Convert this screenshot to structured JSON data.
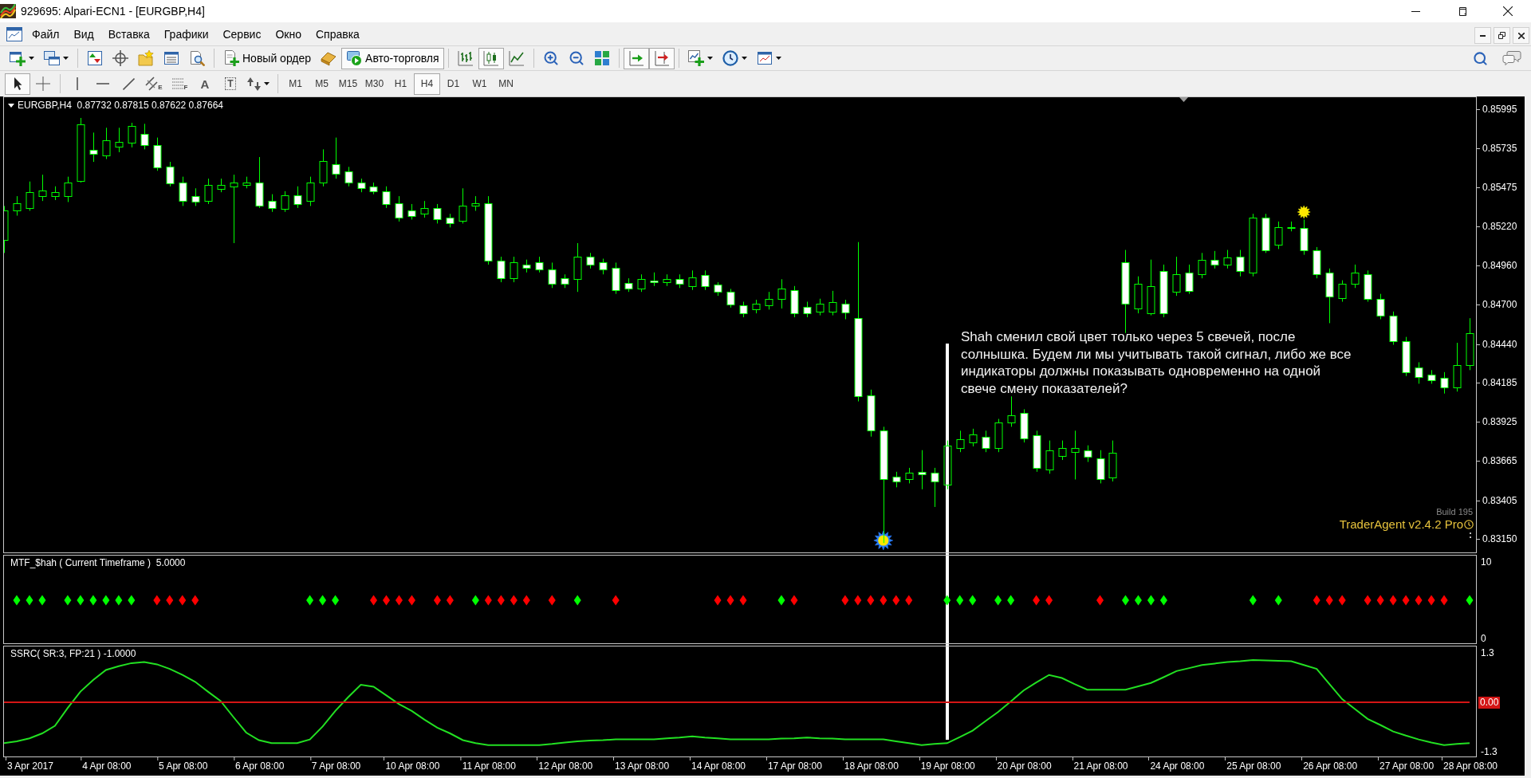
{
  "window": {
    "title": "929695: Alpari-ECN1 - [EURGBP,H4]"
  },
  "menu": {
    "items": [
      "Файл",
      "Вид",
      "Вставка",
      "Графики",
      "Сервис",
      "Окно",
      "Справка"
    ]
  },
  "toolbar": [
    {
      "buttons": [
        {
          "kind": "new_chart",
          "dropdown": true,
          "pressed": false
        },
        {
          "kind": "profiles",
          "dropdown": true,
          "pressed": false
        }
      ]
    },
    {
      "buttons": [
        {
          "kind": "market_watch",
          "dropdown": false,
          "pressed": false
        },
        {
          "kind": "data_window",
          "dropdown": false,
          "pressed": false
        },
        {
          "kind": "navigator",
          "dropdown": false,
          "pressed": false
        },
        {
          "kind": "terminal",
          "dropdown": false,
          "pressed": false
        },
        {
          "kind": "tester",
          "dropdown": false,
          "pressed": false
        }
      ]
    },
    {
      "buttons": [
        {
          "kind": "new_order",
          "label": "Новый ордер",
          "dropdown": false,
          "pressed": false
        },
        {
          "kind": "editor",
          "dropdown": false,
          "pressed": false
        },
        {
          "kind": "auto_trading",
          "label": "Авто-торговля",
          "dropdown": false,
          "pressed": true
        }
      ]
    },
    {
      "buttons": [
        {
          "kind": "bar_chart",
          "dropdown": false,
          "pressed": false
        },
        {
          "kind": "candle_chart",
          "dropdown": false,
          "pressed": true
        },
        {
          "kind": "line_chart",
          "dropdown": false,
          "pressed": false
        }
      ]
    },
    {
      "buttons": [
        {
          "kind": "zoom_in",
          "dropdown": false,
          "pressed": false
        },
        {
          "kind": "zoom_out",
          "dropdown": false,
          "pressed": false
        },
        {
          "kind": "tile",
          "dropdown": false,
          "pressed": false
        }
      ]
    },
    {
      "buttons": [
        {
          "kind": "autoscroll",
          "dropdown": false,
          "pressed": true
        },
        {
          "kind": "chart_shift",
          "dropdown": false,
          "pressed": true
        }
      ]
    },
    {
      "buttons": [
        {
          "kind": "indicators",
          "dropdown": true,
          "pressed": false
        },
        {
          "kind": "periods",
          "dropdown": true,
          "pressed": false
        },
        {
          "kind": "templates",
          "dropdown": true,
          "pressed": false
        }
      ]
    }
  ],
  "toolbar_right": [
    {
      "kind": "search"
    },
    {
      "kind": "chat"
    }
  ],
  "drawing_toolbar": [
    {
      "tools": [
        {
          "kind": "cursor",
          "dropdown": false,
          "selected": true
        },
        {
          "kind": "crosshair",
          "dropdown": false,
          "selected": false
        }
      ]
    },
    {
      "tools": [
        {
          "kind": "vline",
          "dropdown": false,
          "selected": false
        },
        {
          "kind": "hline",
          "dropdown": false,
          "selected": false
        },
        {
          "kind": "trendline",
          "dropdown": false,
          "selected": false
        },
        {
          "kind": "channel",
          "label": "E",
          "dropdown": false,
          "selected": false
        },
        {
          "kind": "fibo",
          "label": "F",
          "dropdown": false,
          "selected": false
        },
        {
          "kind": "text",
          "label": "A",
          "dropdown": false,
          "selected": false
        },
        {
          "kind": "text_label",
          "label": "T",
          "dropdown": false,
          "selected": false
        },
        {
          "kind": "arrows",
          "dropdown": true,
          "selected": false
        }
      ]
    }
  ],
  "timeframes": [
    {
      "label": "M1",
      "selected": false
    },
    {
      "label": "M5",
      "selected": false
    },
    {
      "label": "M15",
      "selected": false
    },
    {
      "label": "M30",
      "selected": false
    },
    {
      "label": "H1",
      "selected": false
    },
    {
      "label": "H4",
      "selected": true
    },
    {
      "label": "D1",
      "selected": false
    },
    {
      "label": "W1",
      "selected": false
    },
    {
      "label": "MN",
      "selected": false
    }
  ],
  "chart": {
    "header": "EURGBP,H4  0.87732 0.87815 0.87622 0.87664",
    "chart_data": {
      "type": "candlestick",
      "ylim": [
        0.8306,
        0.86074
      ],
      "yticks": [
        {
          "value": 0.85995,
          "label": "0.85995"
        },
        {
          "value": 0.85735,
          "label": "0.85735"
        },
        {
          "value": 0.85475,
          "label": "0.85475"
        },
        {
          "value": 0.8522,
          "label": "0.85220"
        },
        {
          "value": 0.8496,
          "label": "0.84960"
        },
        {
          "value": 0.847,
          "label": "0.84700"
        },
        {
          "value": 0.8444,
          "label": "0.84440"
        },
        {
          "value": 0.84185,
          "label": "0.84185"
        },
        {
          "value": 0.83925,
          "label": "0.83925"
        },
        {
          "value": 0.83665,
          "label": "0.83665"
        },
        {
          "value": 0.83405,
          "label": "0.83405"
        },
        {
          "value": 0.8315,
          "label": "0.83150"
        }
      ],
      "categories": [
        null,
        null,
        null,
        null,
        null,
        null,
        null,
        null,
        null,
        null,
        null,
        null,
        null,
        null,
        null,
        null,
        null,
        null,
        null,
        null,
        null,
        null,
        null,
        null,
        null,
        null,
        null,
        null,
        null,
        null,
        null,
        null,
        null,
        null,
        null,
        null,
        null,
        null,
        null,
        null,
        null,
        null,
        null,
        null,
        null,
        null,
        null,
        null,
        null,
        null,
        null,
        null,
        null,
        null,
        null,
        null,
        null,
        null,
        null,
        null,
        null,
        null,
        null,
        null,
        null,
        null,
        null,
        null,
        null,
        null,
        null,
        null,
        null,
        null,
        null,
        null,
        null,
        null,
        null,
        null,
        null,
        null,
        null,
        null,
        null,
        null,
        null,
        null,
        null,
        null,
        null,
        null,
        null,
        null,
        null,
        null,
        null,
        null,
        null,
        null,
        null,
        null,
        null,
        null,
        null,
        null,
        null,
        null,
        null,
        null,
        null,
        null,
        null,
        null,
        null,
        null
      ],
      "ohlc": [
        [
          0.85128,
          0.85354,
          0.85043,
          0.85322
        ],
        [
          0.85322,
          0.85419,
          0.8529,
          0.85374
        ],
        [
          0.85341,
          0.85516,
          0.85322,
          0.85445
        ],
        [
          0.85419,
          0.85561,
          0.85387,
          0.85458
        ],
        [
          0.85419,
          0.85484,
          0.85393,
          0.85445
        ],
        [
          0.85419,
          0.85548,
          0.8538,
          0.85509
        ],
        [
          0.85522,
          0.85937,
          0.85509,
          0.85892
        ],
        [
          0.85723,
          0.8584,
          0.85646,
          0.85697
        ],
        [
          0.8569,
          0.85872,
          0.85665,
          0.85788
        ],
        [
          0.85749,
          0.85872,
          0.8571,
          0.85781
        ],
        [
          0.85775,
          0.85905,
          0.85742,
          0.85885
        ],
        [
          0.85833,
          0.85898,
          0.85729,
          0.85755
        ],
        [
          0.85755,
          0.85807,
          0.85587,
          0.85607
        ],
        [
          0.85613,
          0.85646,
          0.85484,
          0.85503
        ],
        [
          0.85509,
          0.85548,
          0.85354,
          0.85387
        ],
        [
          0.85419,
          0.85471,
          0.85354,
          0.8538
        ],
        [
          0.85387,
          0.85535,
          0.85367,
          0.85496
        ],
        [
          0.85465,
          0.85535,
          0.85445,
          0.85496
        ],
        [
          0.85484,
          0.85561,
          0.85108,
          0.85509
        ],
        [
          0.85496,
          0.85548,
          0.85471,
          0.85509
        ],
        [
          0.85509,
          0.85678,
          0.85341,
          0.85354
        ],
        [
          0.85387,
          0.85432,
          0.85315,
          0.85341
        ],
        [
          0.85335,
          0.85452,
          0.85315,
          0.85426
        ],
        [
          0.85426,
          0.85484,
          0.85341,
          0.85367
        ],
        [
          0.85387,
          0.85548,
          0.85354,
          0.85509
        ],
        [
          0.85509,
          0.85729,
          0.85484,
          0.85652
        ],
        [
          0.85633,
          0.85807,
          0.85535,
          0.85568
        ],
        [
          0.85581,
          0.85613,
          0.85484,
          0.85509
        ],
        [
          0.85509,
          0.85535,
          0.85445,
          0.85471
        ],
        [
          0.85484,
          0.85509,
          0.85432,
          0.85452
        ],
        [
          0.85452,
          0.85484,
          0.85341,
          0.85367
        ],
        [
          0.85374,
          0.85419,
          0.85251,
          0.85277
        ],
        [
          0.85322,
          0.85367,
          0.85264,
          0.8529
        ],
        [
          0.85302,
          0.85387,
          0.85277,
          0.85341
        ],
        [
          0.85341,
          0.85367,
          0.85238,
          0.85264
        ],
        [
          0.85277,
          0.85302,
          0.85212,
          0.85238
        ],
        [
          0.85258,
          0.85471,
          0.85238,
          0.85354
        ],
        [
          0.85354,
          0.85419,
          0.85322,
          0.85374
        ],
        [
          0.85374,
          0.85419,
          0.84966,
          0.84992
        ],
        [
          0.84992,
          0.85018,
          0.84849,
          0.84875
        ],
        [
          0.84875,
          0.85018,
          0.84849,
          0.84979
        ],
        [
          0.84966,
          0.84999,
          0.84914,
          0.84947
        ],
        [
          0.84979,
          0.85018,
          0.84914,
          0.84934
        ],
        [
          0.84934,
          0.84979,
          0.84811,
          0.84837
        ],
        [
          0.84875,
          0.84901,
          0.84811,
          0.84837
        ],
        [
          0.84869,
          0.85108,
          0.84785,
          0.85018
        ],
        [
          0.85018,
          0.85043,
          0.8494,
          0.84966
        ],
        [
          0.84979,
          0.85005,
          0.84901,
          0.84934
        ],
        [
          0.84947,
          0.84979,
          0.84772,
          0.84798
        ],
        [
          0.84843,
          0.84875,
          0.84785,
          0.84805
        ],
        [
          0.84805,
          0.84901,
          0.84785,
          0.84869
        ],
        [
          0.84862,
          0.84914,
          0.84824,
          0.84849
        ],
        [
          0.84849,
          0.84901,
          0.84824,
          0.84869
        ],
        [
          0.84869,
          0.84901,
          0.84811,
          0.84837
        ],
        [
          0.84824,
          0.84927,
          0.84798,
          0.84882
        ],
        [
          0.84895,
          0.84927,
          0.84798,
          0.84824
        ],
        [
          0.84831,
          0.84849,
          0.84759,
          0.84785
        ],
        [
          0.84785,
          0.84805,
          0.84681,
          0.84701
        ],
        [
          0.84694,
          0.8472,
          0.84617,
          0.84643
        ],
        [
          0.84668,
          0.84733,
          0.84643,
          0.84707
        ],
        [
          0.84694,
          0.84785,
          0.84668,
          0.8474
        ],
        [
          0.8474,
          0.84869,
          0.84675,
          0.84805
        ],
        [
          0.84798,
          0.84824,
          0.84617,
          0.84643
        ],
        [
          0.84688,
          0.8472,
          0.84617,
          0.84643
        ],
        [
          0.84655,
          0.8474,
          0.8463,
          0.84707
        ],
        [
          0.84655,
          0.84792,
          0.8463,
          0.8472
        ],
        [
          0.84707,
          0.84733,
          0.84604,
          0.84649
        ],
        [
          0.84611,
          0.85115,
          0.8406,
          0.84093
        ],
        [
          0.84099,
          0.84138,
          0.83827,
          0.83866
        ],
        [
          0.83866,
          0.83892,
          0.83122,
          0.83543
        ],
        [
          0.83562,
          0.83594,
          0.83491,
          0.8353
        ],
        [
          0.83543,
          0.8362,
          0.83517,
          0.83588
        ],
        [
          0.83594,
          0.83737,
          0.83478,
          0.83575
        ],
        [
          0.83588,
          0.8362,
          0.83361,
          0.8353
        ],
        [
          0.83511,
          0.83801,
          0.83478,
          0.83769
        ],
        [
          0.83749,
          0.83866,
          0.83724,
          0.83808
        ],
        [
          0.83788,
          0.83879,
          0.83762,
          0.8384
        ],
        [
          0.83827,
          0.83866,
          0.83724,
          0.83749
        ],
        [
          0.83749,
          0.83944,
          0.83724,
          0.83918
        ],
        [
          0.83918,
          0.84093,
          0.83892,
          0.8397
        ],
        [
          0.83983,
          0.84008,
          0.83788,
          0.83814
        ],
        [
          0.83834,
          0.83866,
          0.83594,
          0.8362
        ],
        [
          0.83607,
          0.83801,
          0.83581,
          0.83737
        ],
        [
          0.83698,
          0.83801,
          0.83672,
          0.83749
        ],
        [
          0.83724,
          0.83866,
          0.83543,
          0.83749
        ],
        [
          0.83737,
          0.83769,
          0.83659,
          0.83692
        ],
        [
          0.83685,
          0.83737,
          0.83517,
          0.83543
        ],
        [
          0.83555,
          0.83801,
          0.8353,
          0.83718
        ],
        [
          0.84979,
          0.85063,
          0.84513,
          0.84707
        ],
        [
          0.84675,
          0.84888,
          0.84643,
          0.84837
        ],
        [
          0.84643,
          0.84999,
          0.8463,
          0.84824
        ],
        [
          0.84921,
          0.84966,
          0.84617,
          0.84643
        ],
        [
          0.84785,
          0.85018,
          0.84759,
          0.84901
        ],
        [
          0.84914,
          0.84966,
          0.84772,
          0.84792
        ],
        [
          0.84901,
          0.85043,
          0.84875,
          0.84999
        ],
        [
          0.84999,
          0.85056,
          0.8494,
          0.84966
        ],
        [
          0.84966,
          0.85063,
          0.8494,
          0.85012
        ],
        [
          0.85018,
          0.85063,
          0.84888,
          0.84921
        ],
        [
          0.84914,
          0.85302,
          0.84888,
          0.85277
        ],
        [
          0.85277,
          0.85302,
          0.85043,
          0.85063
        ],
        [
          0.85095,
          0.85251,
          0.85069,
          0.85212
        ],
        [
          0.85212,
          0.85251,
          0.85186,
          0.85206
        ],
        [
          0.85206,
          0.85264,
          0.85031,
          0.85063
        ],
        [
          0.85063,
          0.85082,
          0.84875,
          0.84901
        ],
        [
          0.84914,
          0.8494,
          0.84578,
          0.84753
        ],
        [
          0.84746,
          0.84862,
          0.8472,
          0.84837
        ],
        [
          0.84837,
          0.84966,
          0.84811,
          0.84914
        ],
        [
          0.84901,
          0.84927,
          0.8472,
          0.8474
        ],
        [
          0.8474,
          0.84772,
          0.84604,
          0.8463
        ],
        [
          0.8463,
          0.84655,
          0.84435,
          0.84461
        ],
        [
          0.84461,
          0.84487,
          0.84228,
          0.84254
        ],
        [
          0.84287,
          0.84319,
          0.84177,
          0.84222
        ],
        [
          0.84235,
          0.84267,
          0.84177,
          0.84202
        ],
        [
          0.84215,
          0.84254,
          0.84112,
          0.84151
        ],
        [
          0.84151,
          0.84448,
          0.84125,
          0.843
        ],
        [
          0.843,
          0.84611,
          0.84267,
          0.84513
        ]
      ]
    },
    "note": "Shah сменил свой цвет только через 5 свечей, после солнышка. Будем ли мы учитывать такой сигнал, либо же все индикаторы должны показывать одновременно на одной свече смену показателей?",
    "expert": {
      "build": "Build 195",
      "name": "TraderAgent v2.4.2 Pro"
    }
  },
  "indicators": [
    {
      "label": "MTF_$hah ( Current Timeframe )  5.0000",
      "chart_data": {
        "type": "scatter",
        "ylim": [
          -0.63,
          10.83
        ],
        "yticks": [
          {
            "value": 10,
            "label": "10"
          },
          {
            "value": 0,
            "label": "0"
          }
        ],
        "categories": [
          null,
          null,
          null,
          null,
          null,
          null,
          null,
          null,
          null,
          null,
          null,
          null,
          null,
          null,
          null,
          null,
          null,
          null,
          null,
          null,
          null,
          null,
          null,
          null,
          null,
          null,
          null,
          null,
          null,
          null,
          null,
          null,
          null,
          null,
          null,
          null,
          null,
          null,
          null,
          null,
          null,
          null,
          null,
          null,
          null,
          null,
          null,
          null,
          null,
          null,
          null,
          null,
          null,
          null,
          null,
          null,
          null,
          null,
          null,
          null,
          null,
          null,
          null,
          null,
          null,
          null,
          null,
          null,
          null,
          null,
          null,
          null,
          null,
          null,
          null,
          null,
          null,
          null,
          null,
          null,
          null,
          null,
          null,
          null,
          null,
          null,
          null,
          null,
          null,
          null,
          null,
          null,
          null,
          null,
          null,
          null,
          null,
          null,
          null,
          null,
          null,
          null,
          null,
          null,
          null,
          null,
          null,
          null,
          null,
          null,
          null,
          null,
          null,
          null,
          null,
          null
        ],
        "series": [
          {
            "color": "#00ff00",
            "values": [
              null,
              5,
              5,
              5,
              null,
              5,
              5,
              5,
              5,
              5,
              5,
              null,
              null,
              null,
              null,
              null,
              null,
              null,
              null,
              null,
              null,
              null,
              null,
              null,
              5,
              5,
              5,
              null,
              null,
              null,
              null,
              null,
              null,
              null,
              null,
              null,
              null,
              5,
              null,
              null,
              null,
              null,
              null,
              null,
              null,
              5,
              null,
              null,
              null,
              null,
              null,
              null,
              null,
              null,
              null,
              null,
              null,
              null,
              null,
              null,
              null,
              5,
              null,
              null,
              null,
              null,
              null,
              null,
              null,
              null,
              null,
              null,
              null,
              null,
              5,
              5,
              5,
              null,
              5,
              5,
              null,
              null,
              null,
              null,
              null,
              null,
              null,
              null,
              5,
              5,
              5,
              5,
              null,
              null,
              null,
              null,
              null,
              null,
              5,
              null,
              5,
              null,
              null,
              null,
              null,
              null,
              null,
              null,
              null,
              null,
              null,
              null,
              null,
              null,
              null,
              5
            ]
          },
          {
            "color": "#ff0000",
            "values": [
              null,
              null,
              null,
              null,
              null,
              null,
              null,
              null,
              null,
              null,
              null,
              null,
              5,
              5,
              5,
              5,
              null,
              null,
              null,
              null,
              null,
              null,
              null,
              null,
              null,
              null,
              null,
              null,
              null,
              5,
              5,
              5,
              5,
              null,
              5,
              5,
              null,
              null,
              5,
              5,
              5,
              5,
              null,
              5,
              null,
              null,
              null,
              null,
              5,
              null,
              null,
              null,
              null,
              null,
              null,
              null,
              5,
              5,
              5,
              null,
              null,
              null,
              5,
              null,
              null,
              null,
              5,
              5,
              5,
              5,
              5,
              5,
              null,
              null,
              null,
              null,
              null,
              null,
              null,
              null,
              null,
              5,
              5,
              null,
              null,
              null,
              5,
              null,
              null,
              null,
              null,
              null,
              null,
              null,
              null,
              null,
              null,
              null,
              null,
              null,
              null,
              null,
              null,
              5,
              5,
              5,
              null,
              5,
              5,
              5,
              5,
              5,
              5,
              5,
              null,
              null
            ]
          }
        ]
      }
    },
    {
      "label": "SSRC( SR:3, FP:21 ) -1.0000",
      "chart_data": {
        "type": "line",
        "ylim": [
          -1.43,
          1.47
        ],
        "yticks": [
          {
            "value": 1.3,
            "label": "1.3"
          },
          {
            "value": 0,
            "label": "0.00"
          },
          {
            "value": -1.3,
            "label": "-1.3"
          }
        ],
        "categories": [
          null,
          null,
          "3 Apr 2017",
          null,
          null,
          null,
          null,
          null,
          "4 Apr 08:00",
          null,
          null,
          null,
          null,
          null,
          "5 Apr 08:00",
          null,
          null,
          null,
          null,
          null,
          "6 Apr 08:00",
          null,
          null,
          null,
          null,
          null,
          "7 Apr 08:00",
          null,
          null,
          null,
          null,
          null,
          "10 Apr 08:00",
          null,
          null,
          null,
          null,
          null,
          "11 Apr 08:00",
          null,
          null,
          null,
          null,
          null,
          "12 Apr 08:00",
          null,
          null,
          null,
          null,
          null,
          "13 Apr 08:00",
          null,
          null,
          null,
          null,
          null,
          "14 Apr 08:00",
          null,
          null,
          null,
          null,
          null,
          "17 Apr 08:00",
          null,
          null,
          null,
          null,
          null,
          "18 Apr 08:00",
          null,
          null,
          null,
          null,
          null,
          "19 Apr 08:00",
          null,
          null,
          null,
          null,
          null,
          "20 Apr 08:00",
          null,
          null,
          null,
          null,
          null,
          "21 Apr 08:00",
          null,
          null,
          null,
          null,
          null,
          "24 Apr 08:00",
          null,
          null,
          null,
          null,
          null,
          "25 Apr 08:00",
          null,
          null,
          null,
          null,
          null,
          "26 Apr 08:00",
          null,
          null,
          null,
          null,
          null,
          "27 Apr 08:00",
          null,
          null,
          null,
          null,
          "28 Apr 08:00"
        ],
        "series": [
          {
            "color": "#22e022",
            "values": [
              -1.08,
              -1.03,
              -0.95,
              -0.82,
              -0.62,
              -0.15,
              0.28,
              0.59,
              0.85,
              0.95,
              1.03,
              1.06,
              1.0,
              0.88,
              0.72,
              0.54,
              0.28,
              0.03,
              -0.39,
              -0.8,
              -1.0,
              -1.08,
              -1.08,
              -1.08,
              -0.98,
              -0.64,
              -0.23,
              0.13,
              0.46,
              0.41,
              0.18,
              -0.05,
              -0.23,
              -0.46,
              -0.67,
              -0.82,
              -1.0,
              -1.08,
              -1.13,
              -1.13,
              -1.13,
              -1.13,
              -1.13,
              -1.1,
              -1.06,
              -1.03,
              -1.01,
              -1.0,
              -0.98,
              -0.98,
              -0.98,
              -0.98,
              -0.95,
              -0.93,
              -0.9,
              -0.93,
              -0.95,
              -0.98,
              -0.98,
              -0.98,
              -0.98,
              -0.96,
              -0.95,
              -0.93,
              -0.95,
              -0.96,
              -0.98,
              -0.98,
              -0.98,
              -0.98,
              -1.03,
              -1.08,
              -1.13,
              -1.1,
              -1.08,
              -0.92,
              -0.75,
              -0.5,
              -0.26,
              0.02,
              0.31,
              0.52,
              0.72,
              0.64,
              0.48,
              0.33,
              0.33,
              0.33,
              0.33,
              0.42,
              0.51,
              0.66,
              0.82,
              0.9,
              0.98,
              1.02,
              1.06,
              1.08,
              1.11,
              1.1,
              1.09,
              1.08,
              0.98,
              0.88,
              0.48,
              0.08,
              -0.18,
              -0.44,
              -0.6,
              -0.77,
              -0.88,
              -0.98,
              -1.06,
              -1.13,
              -1.1,
              -1.08
            ]
          },
          {
            "color": "#d41515",
            "values": [
              0,
              0,
              0,
              0,
              0,
              0,
              0,
              0,
              0,
              0,
              0,
              0,
              0,
              0,
              0,
              0,
              0,
              0,
              0,
              0,
              0,
              0,
              0,
              0,
              0,
              0,
              0,
              0,
              0,
              0,
              0,
              0,
              0,
              0,
              0,
              0,
              0,
              0,
              0,
              0,
              0,
              0,
              0,
              0,
              0,
              0,
              0,
              0,
              0,
              0,
              0,
              0,
              0,
              0,
              0,
              0,
              0,
              0,
              0,
              0,
              0,
              0,
              0,
              0,
              0,
              0,
              0,
              0,
              0,
              0,
              0,
              0,
              0,
              0,
              0,
              0,
              0,
              0,
              0,
              0,
              0,
              0,
              0,
              0,
              0,
              0,
              0,
              0,
              0,
              0,
              0,
              0,
              0,
              0,
              0,
              0,
              0,
              0,
              0,
              0,
              0,
              0,
              0,
              0,
              0,
              0,
              0,
              0,
              0,
              0,
              0,
              0,
              0,
              0,
              0,
              0
            ]
          }
        ]
      }
    }
  ]
}
